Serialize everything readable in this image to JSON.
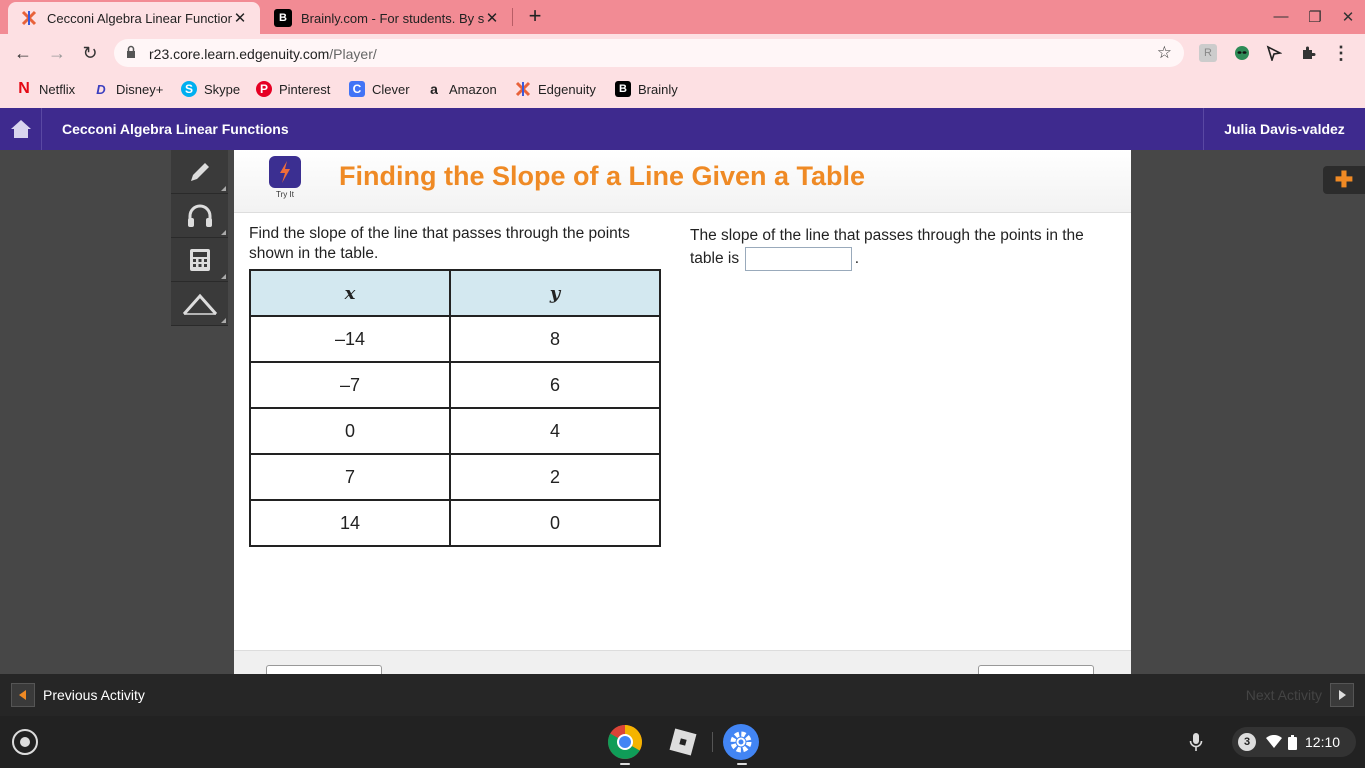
{
  "browser": {
    "tabs": [
      {
        "title": "Cecconi Algebra Linear Functions",
        "active": true
      },
      {
        "title": "Brainly.com - For students. By students.",
        "active": false
      }
    ],
    "url_host": "r23.core.learn.edgenuity.com",
    "url_path": "/Player/"
  },
  "bookmarks": [
    {
      "label": "Netflix",
      "icon": "netflix-icon",
      "color": "#e50914"
    },
    {
      "label": "Disney+",
      "icon": "disney-icon",
      "color": "#3b3fbf"
    },
    {
      "label": "Skype",
      "icon": "skype-icon",
      "color": "#00aff0"
    },
    {
      "label": "Pinterest",
      "icon": "pinterest-icon",
      "color": "#e60023"
    },
    {
      "label": "Clever",
      "icon": "clever-icon",
      "color": "#4274f6"
    },
    {
      "label": "Amazon",
      "icon": "amazon-icon",
      "color": "#222222"
    },
    {
      "label": "Edgenuity",
      "icon": "edgenuity-icon",
      "color": "#e8623a"
    },
    {
      "label": "Brainly",
      "icon": "brainly-icon",
      "color": "#000000"
    }
  ],
  "app": {
    "course_title": "Cecconi Algebra Linear Functions",
    "user_name": "Julia Davis-valdez",
    "accent": "#3e2a8e"
  },
  "lesson": {
    "badge_label": "Try It",
    "title": "Finding the Slope of a Line Given a Table",
    "title_color": "#ef8a25",
    "question": "Find the slope of the line that passes through the points shown in the table.",
    "table": {
      "headers": [
        "x",
        "y"
      ],
      "rows": [
        [
          "–14",
          "8"
        ],
        [
          "–7",
          "6"
        ],
        [
          "0",
          "4"
        ],
        [
          "7",
          "2"
        ],
        [
          "14",
          "0"
        ]
      ]
    },
    "answer_prefix": "The slope of the line that passes through the points in the table is",
    "answer_suffix": ".",
    "answer_value": ""
  },
  "activity": {
    "prev_label": "Previous Activity",
    "next_label": "Next Activity"
  },
  "shelf": {
    "notification_count": "3",
    "time": "12:10"
  }
}
